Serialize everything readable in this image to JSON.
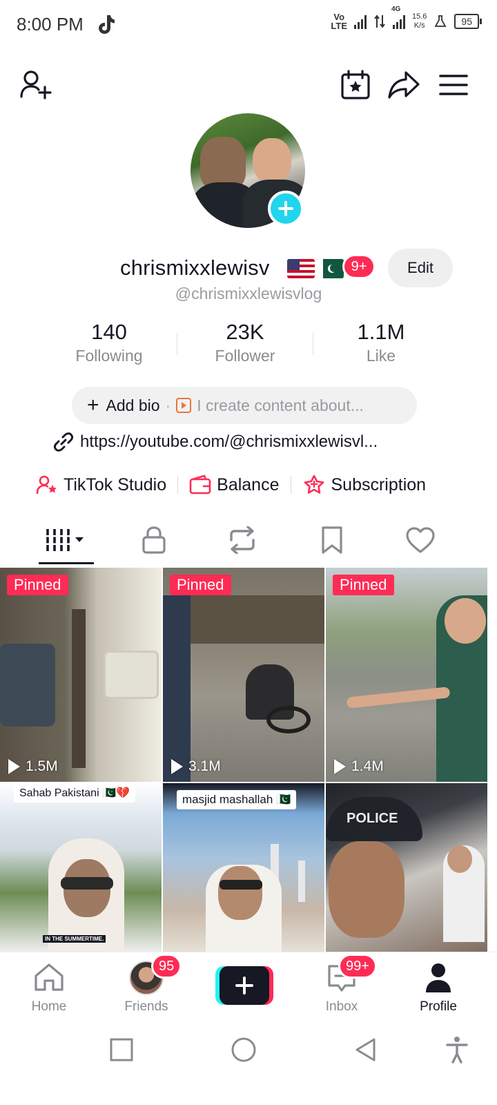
{
  "status_bar": {
    "time": "8:00 PM",
    "volte_top": "Vo",
    "volte_bottom": "LTE",
    "network": "4G",
    "speed_value": "15.6",
    "speed_unit": "K/s",
    "battery": "95"
  },
  "top_bar": {
    "icons": [
      "add-friend-icon",
      "calendar-star-icon",
      "share-icon",
      "menu-icon"
    ]
  },
  "profile": {
    "display_name": "chrismixxlewisv",
    "flags": [
      "US flag",
      "Pakistan flag"
    ],
    "name_badge": "9+",
    "edit_label": "Edit",
    "username": "@chrismixxlewisvlog"
  },
  "stats": [
    {
      "value": "140",
      "label": "Following"
    },
    {
      "value": "23K",
      "label": "Follower"
    },
    {
      "value": "1.1M",
      "label": "Like"
    }
  ],
  "bio": {
    "add_label": "Add bio",
    "hint": "I create content about..."
  },
  "link": {
    "text": "https://youtube.com/@chrismixxlewisvl..."
  },
  "tools": [
    {
      "label": "TikTok Studio",
      "icon": "studio-icon"
    },
    {
      "label": "Balance",
      "icon": "wallet-icon"
    },
    {
      "label": "Subscription",
      "icon": "subscription-icon"
    }
  ],
  "tabs": [
    "videos-grid",
    "private",
    "reposts",
    "saved",
    "liked"
  ],
  "videos": [
    {
      "pinned": "Pinned",
      "views": "1.5M",
      "caption": ""
    },
    {
      "pinned": "Pinned",
      "views": "3.1M",
      "caption": ""
    },
    {
      "pinned": "Pinned",
      "views": "1.4M",
      "caption": ""
    },
    {
      "pinned": "",
      "views": "",
      "caption": "Sahab Pakistani 🇵🇰💔",
      "subcaption": "IN THE SUMMERTIME."
    },
    {
      "pinned": "",
      "views": "",
      "caption": "masjid mashallah 🇵🇰"
    },
    {
      "pinned": "",
      "views": "",
      "caption": "",
      "badge": "POLICE"
    }
  ],
  "bottom_nav": {
    "home": "Home",
    "friends": "Friends",
    "friends_badge": "95",
    "inbox": "Inbox",
    "inbox_badge": "99+",
    "profile": "Profile"
  },
  "colors": {
    "accent": "#fe2c55",
    "cyan": "#25f4ee",
    "text": "#161823",
    "muted": "#8a8b91"
  }
}
